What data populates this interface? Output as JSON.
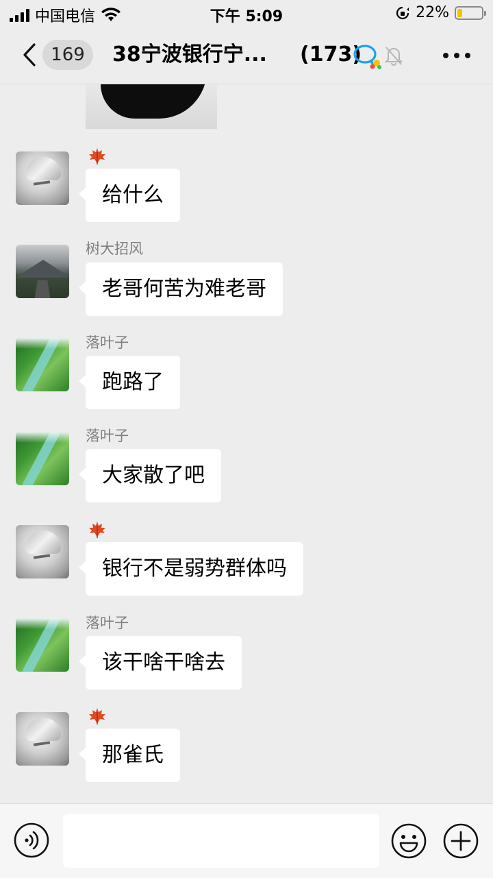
{
  "status_bar": {
    "carrier": "中国电信",
    "time": "下午 5:09",
    "battery_percent": "22%",
    "battery_level": 0.22
  },
  "nav": {
    "unread_count": "169",
    "title": "38宁波银行宁...",
    "member_count": "(173)"
  },
  "messages": [
    {
      "avatar": "anime-avatar",
      "sender": "",
      "badge": "maple-leaf-icon",
      "text": "给什么"
    },
    {
      "avatar": "mountain-road-avatar",
      "sender": "树大招风",
      "text": "老哥何苦为难老哥"
    },
    {
      "avatar": "green-valley-avatar",
      "sender": "落叶子",
      "text": "跑路了"
    },
    {
      "avatar": "green-valley-avatar",
      "sender": "落叶子",
      "text": "大家散了吧"
    },
    {
      "avatar": "anime-avatar",
      "sender": "",
      "badge": "maple-leaf-icon",
      "text": "银行不是弱势群体吗"
    },
    {
      "avatar": "green-valley-avatar",
      "sender": "落叶子",
      "text": "该干啥干啥去"
    },
    {
      "avatar": "anime-avatar",
      "sender": "",
      "badge": "maple-leaf-icon",
      "text": "那雀氏"
    }
  ],
  "input": {
    "value": "",
    "placeholder": ""
  },
  "colors": {
    "background": "#ededed",
    "bubble": "#ffffff",
    "battery_fill": "#f5c400",
    "chat_icon_blue": "#1aa1f0"
  }
}
